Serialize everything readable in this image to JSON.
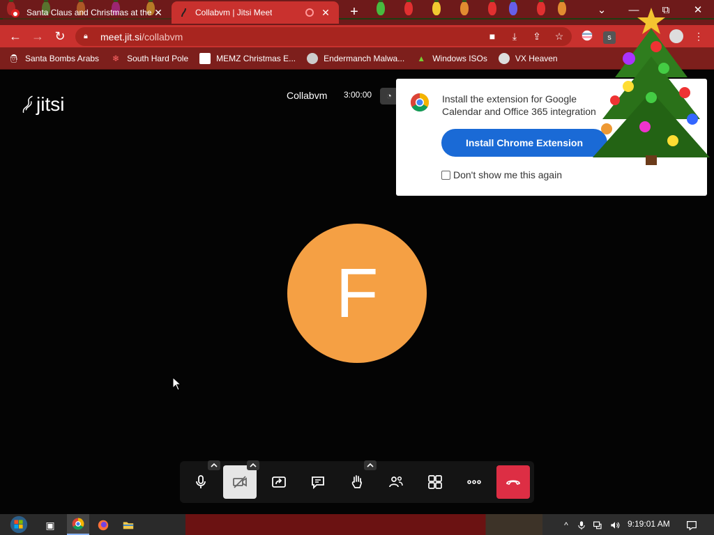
{
  "tabs": [
    {
      "title": "Santa Claus and Christmas at the",
      "close": "✕"
    },
    {
      "title": "Collabvm | Jitsi Meet",
      "close": "✕"
    }
  ],
  "new_tab": "+",
  "window_controls": {
    "dropdown": "⌄",
    "minimize": "—",
    "restore": "⧉",
    "close": "✕"
  },
  "address": {
    "host": "meet.jit.si",
    "path": "/collabvm"
  },
  "bookmarks": [
    {
      "label": "Santa Bombs Arabs",
      "icon": "santa-icon"
    },
    {
      "label": "South Hard Pole",
      "icon": "snowflake-icon"
    },
    {
      "label": "MEMZ Christmas E...",
      "icon": "page-icon"
    },
    {
      "label": "Endermanch Malwa...",
      "icon": "raccoon-icon"
    },
    {
      "label": "Windows ISOs",
      "icon": "tree-icon"
    },
    {
      "label": "VX Heaven",
      "icon": "vx-icon"
    }
  ],
  "meeting": {
    "logo_text": "jitsi",
    "name": "Collabvm",
    "timer": "3:00:00",
    "avatar_letter": "F"
  },
  "extension_popup": {
    "message": "Install the extension for Google Calendar and Office 365 integration",
    "button": "Install Chrome Extension",
    "checkbox_label": "Don't show me this again"
  },
  "taskbar": {
    "clock": "9:19:01 AM"
  },
  "colors": {
    "avatar": "#f5a044",
    "hangup": "#dd2e44",
    "install_button": "#1a6ad6",
    "tab_active": "#c9312e"
  }
}
